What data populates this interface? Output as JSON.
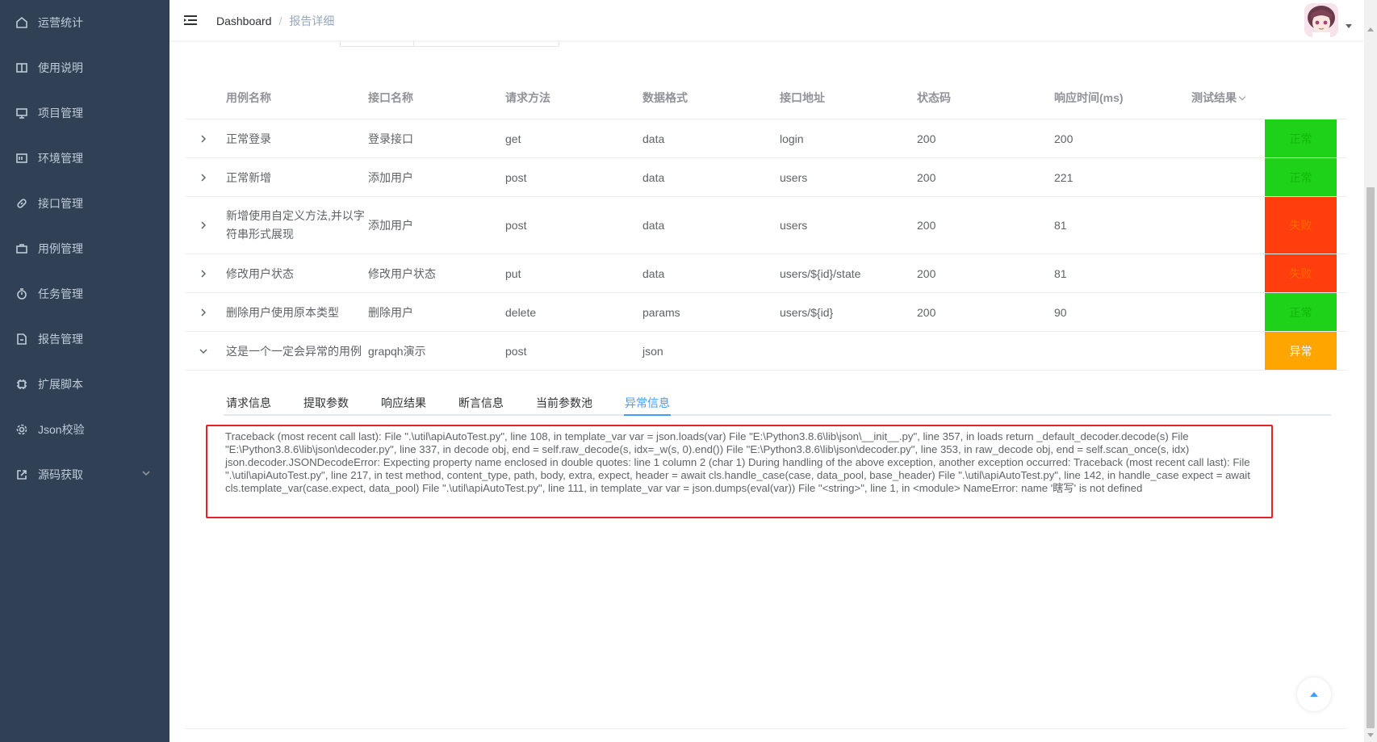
{
  "sidebar": {
    "items": [
      {
        "label": "运营统计",
        "icon": "home-icon"
      },
      {
        "label": "使用说明",
        "icon": "book-icon"
      },
      {
        "label": "项目管理",
        "icon": "monitor-icon"
      },
      {
        "label": "环境管理",
        "icon": "box-icon"
      },
      {
        "label": "接口管理",
        "icon": "link-icon"
      },
      {
        "label": "用例管理",
        "icon": "briefcase-icon"
      },
      {
        "label": "任务管理",
        "icon": "timer-icon"
      },
      {
        "label": "报告管理",
        "icon": "document-icon"
      },
      {
        "label": "扩展脚本",
        "icon": "cpu-icon"
      },
      {
        "label": "Json校验",
        "icon": "gear-icon"
      },
      {
        "label": "源码获取",
        "icon": "share-icon"
      }
    ]
  },
  "header": {
    "breadcrumb": {
      "home": "Dashboard",
      "separator": "/",
      "current": "报告详细"
    }
  },
  "table": {
    "columns": [
      "用例名称",
      "接口名称",
      "请求方法",
      "数据格式",
      "接口地址",
      "状态码",
      "响应时间(ms)",
      "测试结果"
    ],
    "rows": [
      {
        "case": "正常登录",
        "api": "登录接口",
        "method": "get",
        "format": "data",
        "path": "login",
        "code": "200",
        "time": "200",
        "result": "正常",
        "color": "#1ed219"
      },
      {
        "case": "正常新增",
        "api": "添加用户",
        "method": "post",
        "format": "data",
        "path": "users",
        "code": "200",
        "time": "221",
        "result": "正常",
        "color": "#1ed219"
      },
      {
        "case": "新增使用自定义方法,并以字符串形式展现",
        "api": "添加用户",
        "method": "post",
        "format": "data",
        "path": "users",
        "code": "200",
        "time": "81",
        "result": "失败",
        "color": "#ff3d0d"
      },
      {
        "case": "修改用户状态",
        "api": "修改用户状态",
        "method": "put",
        "format": "data",
        "path": "users/${id}/state",
        "code": "200",
        "time": "81",
        "result": "失败",
        "color": "#ff3d0d"
      },
      {
        "case": "删除用户使用原本类型",
        "api": "删除用户",
        "method": "delete",
        "format": "params",
        "path": "users/${id}",
        "code": "200",
        "time": "90",
        "result": "正常",
        "color": "#1ed219"
      },
      {
        "case": "这是一个一定会异常的用例",
        "api": "grapqh演示",
        "method": "post",
        "format": "json",
        "path": "",
        "code": "",
        "time": "",
        "result": "异常",
        "color": "#ffa500"
      }
    ]
  },
  "tabs": [
    "请求信息",
    "提取参数",
    "响应结果",
    "断言信息",
    "当前参数池",
    "异常信息"
  ],
  "active_tab": "异常信息",
  "traceback": "Traceback (most recent call last): File \".\\util\\apiAutoTest.py\", line 108, in template_var var = json.loads(var) File \"E:\\Python3.8.6\\lib\\json\\__init__.py\", line 357, in loads return _default_decoder.decode(s) File \"E:\\Python3.8.6\\lib\\json\\decoder.py\", line 337, in decode obj, end = self.raw_decode(s, idx=_w(s, 0).end()) File \"E:\\Python3.8.6\\lib\\json\\decoder.py\", line 353, in raw_decode obj, end = self.scan_once(s, idx) json.decoder.JSONDecodeError: Expecting property name enclosed in double quotes: line 1 column 2 (char 1) During handling of the above exception, another exception occurred: Traceback (most recent call last): File \".\\util\\apiAutoTest.py\", line 217, in test method, content_type, path, body, extra, expect, header = await cls.handle_case(case, data_pool, base_header) File \".\\util\\apiAutoTest.py\", line 142, in handle_case expect = await cls.template_var(case.expect, data_pool) File \".\\util\\apiAutoTest.py\", line 111, in template_var var = json.dumps(eval(var)) File \"<string>\", line 1, in <module> NameError: name '瞎写' is not defined",
  "colors": {
    "sidebar_bg": "#304156",
    "accent": "#409eff",
    "highlight_box": "#e8202a",
    "ok": "#1ed219",
    "fail": "#ff3d0d",
    "error": "#ffa500"
  }
}
